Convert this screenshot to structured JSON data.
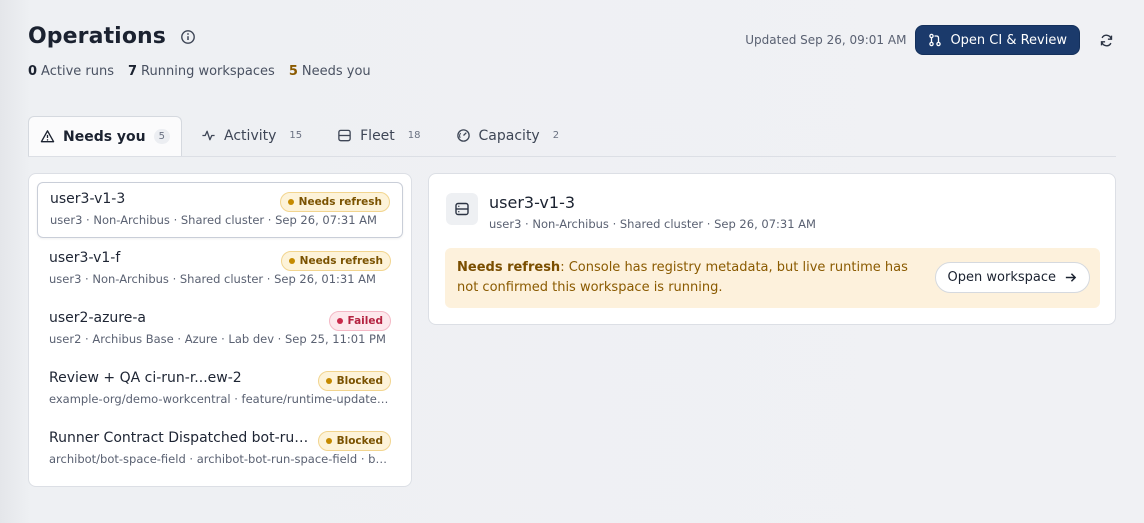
{
  "header": {
    "title": "Operations",
    "updated": "Updated Sep 26, 09:01 AM",
    "ci_button": "Open CI & Review",
    "stats": [
      {
        "count": "0",
        "label": "Active runs"
      },
      {
        "count": "7",
        "label": "Running workspaces"
      },
      {
        "count": "5",
        "label": "Needs you"
      }
    ]
  },
  "tabs": [
    {
      "label": "Needs you",
      "count": "5",
      "icon": "warning-icon"
    },
    {
      "label": "Activity",
      "count": "15",
      "icon": "activity-icon"
    },
    {
      "label": "Fleet",
      "count": "18",
      "icon": "server-icon"
    },
    {
      "label": "Capacity",
      "count": "2",
      "icon": "gauge-icon"
    }
  ],
  "items": [
    {
      "title": "user3-v1-3",
      "sub": "user3 · Non-Archibus · Shared cluster · Sep 26, 07:31 AM",
      "badge": "Needs refresh"
    },
    {
      "title": "user3-v1-f",
      "sub": "user3 · Non-Archibus · Shared cluster · Sep 26, 01:31 AM",
      "badge": "Needs refresh"
    },
    {
      "title": "user2-azure-a",
      "sub": "user2 · Archibus Base · Azure · Lab dev · Sep 25, 11:01 PM",
      "badge": "Failed"
    },
    {
      "title": "Review + QA ci-run-r...ew-2",
      "sub": "example-org/demo-workcentral · feature/runtime-update -> ...",
      "badge": "Blocked"
    },
    {
      "title": "Runner Contract Dispatched bot-run-...i...",
      "sub": "archibot/bot-space-field · archibot-bot-run-space-field · bot...",
      "badge": "Blocked"
    }
  ],
  "detail": {
    "title": "user3-v1-3",
    "sub": "user3 · Non-Archibus · Shared cluster · Sep 26, 07:31 AM",
    "alert_label": "Needs refresh",
    "alert_text": ": Console has registry metadata, but live runtime has not confirmed this workspace is running.",
    "open_button": "Open workspace"
  },
  "colors": {
    "primary": "#1b3a6b",
    "warning": "#c58a00",
    "danger": "#c92a4a"
  }
}
